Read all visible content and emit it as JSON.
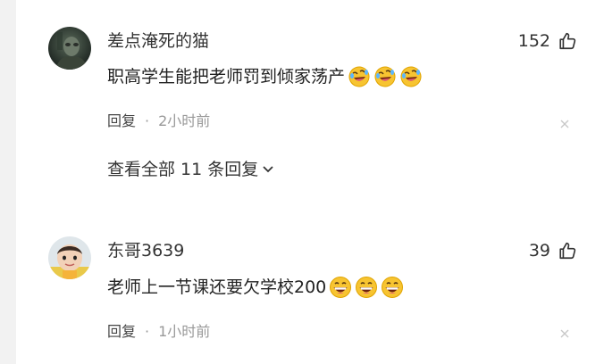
{
  "comments": [
    {
      "username": "差点淹死的猫",
      "likes": "152",
      "text": "职高学生能把老师罚到倾家荡产",
      "emojis": [
        "rofl-emoji",
        "rofl-emoji",
        "rofl-emoji"
      ],
      "reply_label": "回复",
      "separator": "·",
      "time": "2小时前",
      "view_replies": "查看全部 11 条回复"
    },
    {
      "username": "东哥3639",
      "likes": "39",
      "text": "老师上一节课还要欠学校200",
      "emojis": [
        "grin-emoji",
        "grin-emoji",
        "grin-emoji"
      ],
      "reply_label": "回复",
      "separator": "·",
      "time": "1小时前"
    }
  ],
  "icons": {
    "like": "thumbs-up-icon",
    "close": "close-icon",
    "chevron": "chevron-down-icon"
  },
  "colors": {
    "text": "#222222",
    "muted": "#999999",
    "emoji_yellow": "#f7c431"
  }
}
